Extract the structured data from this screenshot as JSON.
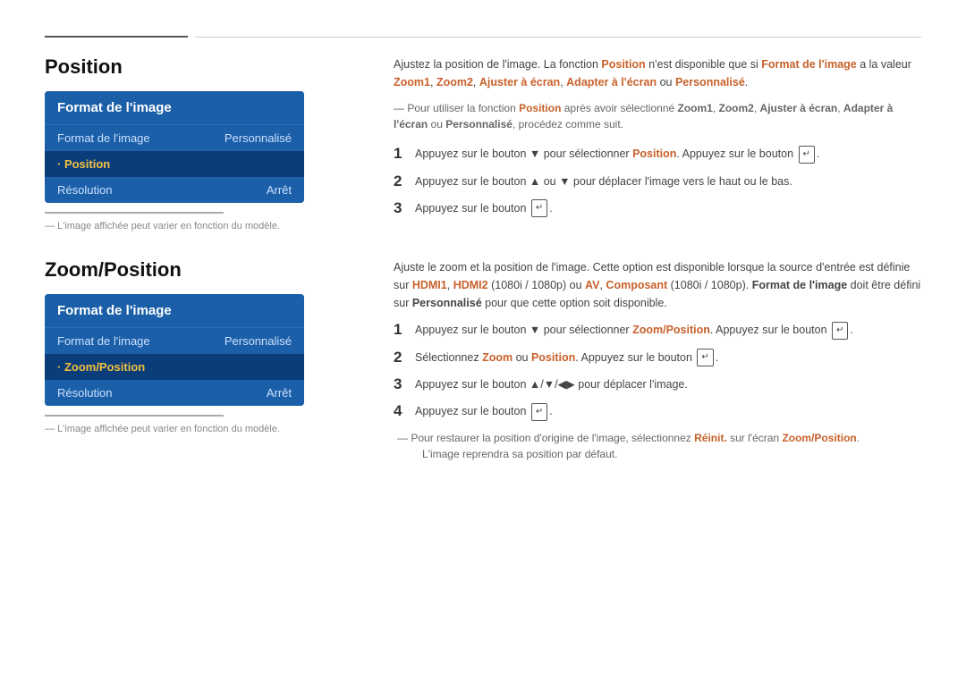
{
  "topline": {
    "left_width": 160
  },
  "position_section": {
    "title": "Position",
    "menu": {
      "header": "Format de l'image",
      "rows": [
        {
          "label": "Format de l'image",
          "value": "Personnalisé",
          "selected": false
        },
        {
          "label": "· Position",
          "value": "",
          "selected": true
        },
        {
          "label": "Résolution",
          "value": "Arrêt",
          "selected": false
        }
      ]
    },
    "note": "L'image affichée peut varier en fonction du modèle.",
    "description": "Ajustez la position de l'image. La fonction Position n'est disponible que si Format de l'image a la valeur Zoom1, Zoom2, Ajuster à écran, Adapter à l'écran ou Personnalisé.",
    "sub_note": "Pour utiliser la fonction Position après avoir sélectionné Zoom1, Zoom2, Ajuster à écran, Adapter à l'écran ou Personnalisé, procédez comme suit.",
    "steps": [
      {
        "num": "1",
        "text": "Appuyez sur le bouton ▼ pour sélectionner Position. Appuyez sur le bouton ↵."
      },
      {
        "num": "2",
        "text": "Appuyez sur le bouton ▲ ou ▼ pour déplacer l'image vers le haut ou le bas."
      },
      {
        "num": "3",
        "text": "Appuyez sur le bouton ↵."
      }
    ]
  },
  "zoom_section": {
    "title": "Zoom/Position",
    "menu": {
      "header": "Format de l'image",
      "rows": [
        {
          "label": "Format de l'image",
          "value": "Personnalisé",
          "selected": false
        },
        {
          "label": "· Zoom/Position",
          "value": "",
          "selected": true
        },
        {
          "label": "Résolution",
          "value": "Arrêt",
          "selected": false
        }
      ]
    },
    "note": "L'image affichée peut varier en fonction du modèle.",
    "description": "Ajuste le zoom et la position de l'image. Cette option est disponible lorsque la source d'entrée est définie sur HDMI1, HDMI2 (1080i / 1080p) ou AV, Composant (1080i / 1080p). Format de l'image doit être défini sur Personnalisé pour que cette option soit disponible.",
    "steps": [
      {
        "num": "1",
        "text": "Appuyez sur le bouton ▼ pour sélectionner Zoom/Position. Appuyez sur le bouton ↵."
      },
      {
        "num": "2",
        "text": "Sélectionnez Zoom ou Position. Appuyez sur le bouton ↵."
      },
      {
        "num": "3",
        "text": "Appuyez sur le bouton ▲/▼/◀▶ pour déplacer l'image."
      },
      {
        "num": "4",
        "text": "Appuyez sur le bouton ↵."
      }
    ],
    "sub_note_line1": "Pour restaurer la position d'origine de l'image, sélectionnez Réinit. sur l'écran Zoom/Position.",
    "sub_note_line2": "L'image reprendra sa position par défaut."
  }
}
